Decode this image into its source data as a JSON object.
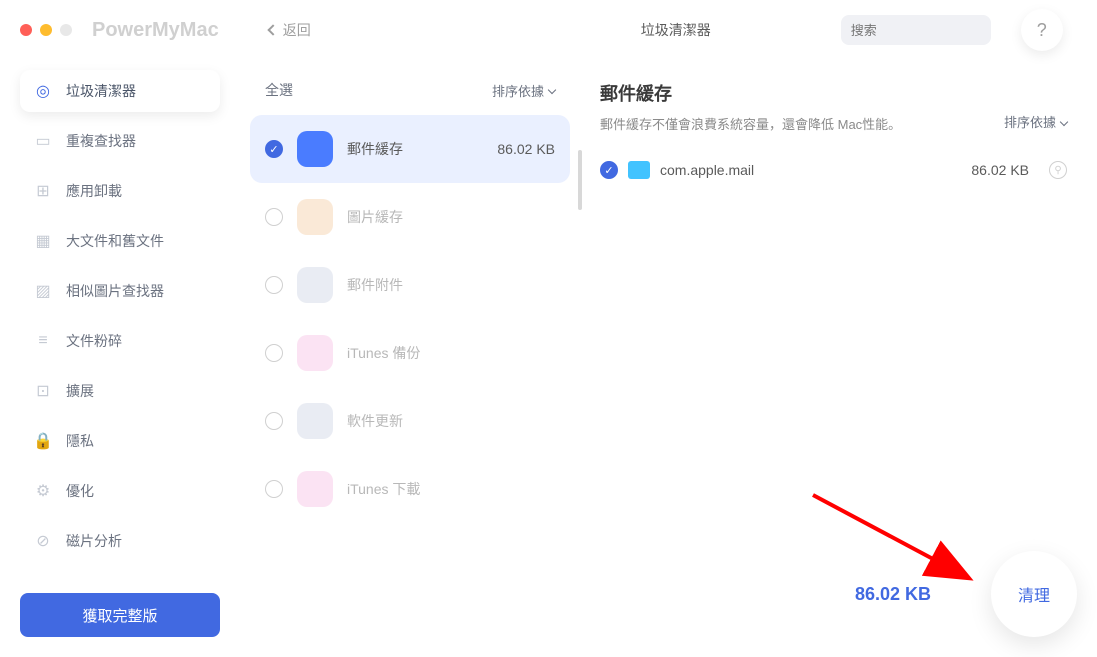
{
  "header": {
    "app_name": "PowerMyMac",
    "back": "返回",
    "top_title": "垃圾清潔器",
    "search_placeholder": "搜索"
  },
  "sidebar": {
    "items": [
      {
        "label": "垃圾清潔器"
      },
      {
        "label": "重複查找器"
      },
      {
        "label": "應用卸載"
      },
      {
        "label": "大文件和舊文件"
      },
      {
        "label": "相似圖片查找器"
      },
      {
        "label": "文件粉碎"
      },
      {
        "label": "擴展"
      },
      {
        "label": "隱私"
      },
      {
        "label": "優化"
      },
      {
        "label": "磁片分析"
      }
    ],
    "upgrade": "獲取完整版"
  },
  "middle": {
    "select_all": "全選",
    "sort": "排序依據",
    "items": [
      {
        "name": "郵件緩存",
        "size": "86.02 KB",
        "checked": true,
        "selected": true,
        "icon_bg": "#4a7cff"
      },
      {
        "name": "圖片緩存",
        "size": "",
        "checked": false,
        "icon_bg": "#f5d4b0"
      },
      {
        "name": "郵件附件",
        "size": "",
        "checked": false,
        "icon_bg": "#d4dae8"
      },
      {
        "name": "iTunes 備份",
        "size": "",
        "checked": false,
        "icon_bg": "#f8c8e8"
      },
      {
        "name": "軟件更新",
        "size": "",
        "checked": false,
        "icon_bg": "#d4dae8"
      },
      {
        "name": "iTunes 下載",
        "size": "",
        "checked": false,
        "icon_bg": "#f8c8e8"
      }
    ]
  },
  "right": {
    "title": "郵件緩存",
    "desc": "郵件緩存不僅會浪費系統容量，還會降低 Mac性能。",
    "sort": "排序依據",
    "files": [
      {
        "name": "com.apple.mail",
        "size": "86.02 KB"
      }
    ],
    "total": "86.02 KB",
    "clean": "清理"
  }
}
